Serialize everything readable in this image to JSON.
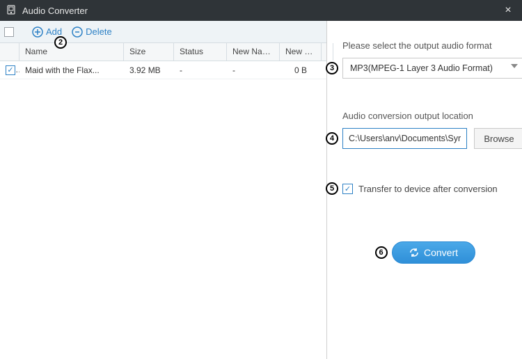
{
  "window": {
    "title": "Audio Converter"
  },
  "toolbar": {
    "add_label": "Add",
    "delete_label": "Delete"
  },
  "columns": {
    "name": "Name",
    "size": "Size",
    "status": "Status",
    "new_name": "New Name",
    "new_size": "New Size"
  },
  "rows": [
    {
      "checked": true,
      "name": "Maid with the Flax...",
      "size": "3.92 MB",
      "status": "-",
      "new_name": "-",
      "new_size": "0 B"
    }
  ],
  "right": {
    "format_label": "Please select the output audio format",
    "format_value": "MP3(MPEG-1 Layer 3 Audio Format)",
    "output_label": "Audio conversion output location",
    "output_path": "C:\\Users\\anv\\Documents\\Syr",
    "browse_label": "Browse",
    "transfer_label": "Transfer to device after conversion",
    "transfer_checked": true,
    "convert_label": "Convert"
  },
  "callouts": {
    "c2": "2",
    "c3": "3",
    "c4": "4",
    "c5": "5",
    "c6": "6"
  }
}
